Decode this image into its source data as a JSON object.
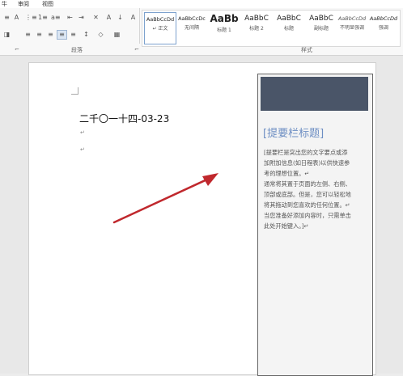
{
  "tabs": [
    {
      "label": "牛"
    },
    {
      "label": "审阅"
    },
    {
      "label": "视图"
    }
  ],
  "groups": {
    "paragraph": "段落",
    "styles": "样式",
    "launcher": "⌐"
  },
  "toolbar": {
    "row1": [
      "≡",
      "A",
      "⋮≡",
      "1≡",
      "a≡",
      "⇤",
      "⇥",
      "✕",
      "A",
      "↓",
      "A"
    ],
    "row2": [
      "◨",
      "≡",
      "≡",
      "≡",
      "≡",
      "≡",
      "↕",
      "◇",
      "▦"
    ]
  },
  "styles": [
    {
      "sample": "AaBbCcDd",
      "name": "↵ 正文",
      "selected": true
    },
    {
      "sample": "AaBbCcDc",
      "name": "无间隔",
      "selected": false
    },
    {
      "sample": "AaBb",
      "name": "标题 1",
      "selected": false
    },
    {
      "sample": "AaBbC",
      "name": "标题 2",
      "selected": false
    },
    {
      "sample": "AaBbC",
      "name": "标题",
      "selected": false
    },
    {
      "sample": "AaBbC",
      "name": "副标题",
      "selected": false
    },
    {
      "sample": "AaBbCcDd",
      "name": "不明显强调",
      "selected": false
    },
    {
      "sample": "AaBbCcDd",
      "name": "强调",
      "selected": false
    }
  ],
  "document": {
    "date": "二千〇一十四-03-23",
    "para_mark": "↵"
  },
  "sidebar": {
    "title": "[提要栏标题]",
    "lines": [
      "[提要栏是突出您的文字要点或添",
      "加附加信息(如日程表)以供快速参",
      "考的理想位置。↵",
      "通常将其置于页面的左侧、右侧、",
      "顶部或底部。但是，您可以轻松地",
      "将其拖动到您喜欢的任何位置。↵",
      "当您准备好添加内容时，只需单击",
      "此处开始键入。]↵"
    ]
  },
  "colors": {
    "sidebar_header": "#4a5568",
    "sidebar_title": "#6d8ec3",
    "arrow": "#c0282d"
  }
}
